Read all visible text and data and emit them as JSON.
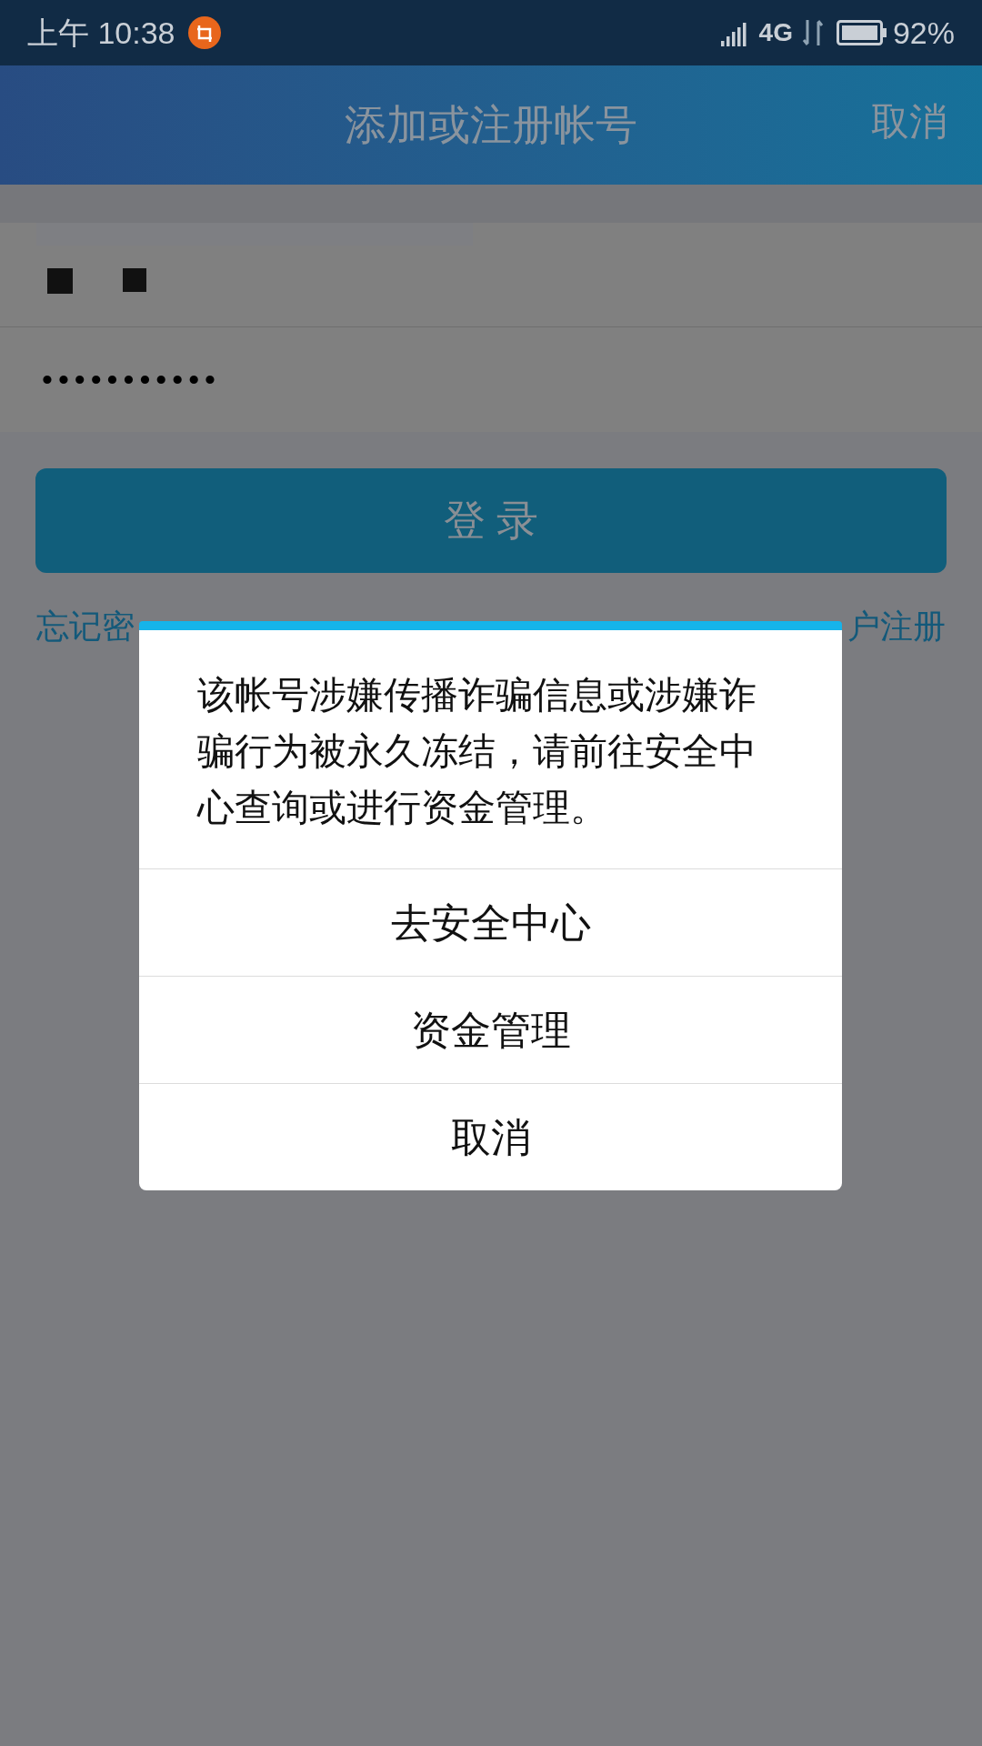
{
  "status_bar": {
    "time": "上午 10:38",
    "network": "4G",
    "battery": "92%"
  },
  "nav_bar": {
    "title": "添加或注册帐号",
    "cancel": "取消"
  },
  "form": {
    "password": "•••••••••••",
    "login_button": "登 录",
    "forgot_link": "忘记密",
    "register_link": "户注册"
  },
  "dialog": {
    "message": "该帐号涉嫌传播诈骗信息或涉嫌诈骗行为被永久冻结，请前往安全中心查询或进行资金管理。",
    "buttons": [
      "去安全中心",
      "资金管理",
      "取消"
    ]
  }
}
